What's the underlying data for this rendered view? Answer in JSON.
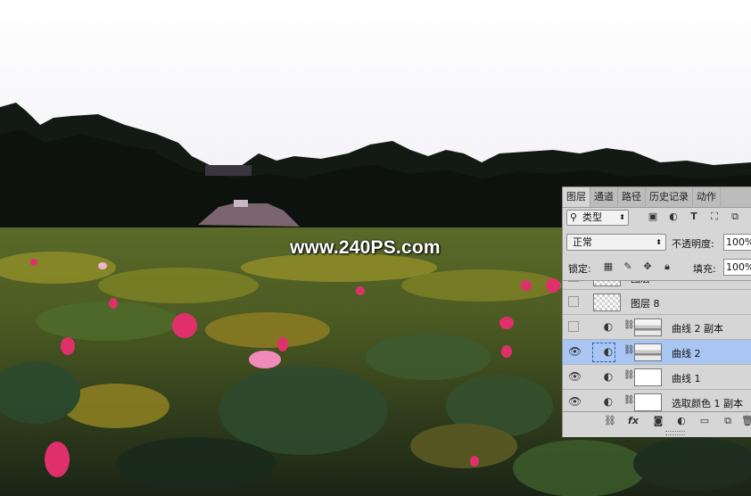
{
  "watermark": "www.240PS.com",
  "layers_panel": {
    "tabs": [
      "图层",
      "通道",
      "路径",
      "历史记录",
      "动作"
    ],
    "active_tab": "图层",
    "kind_filter": "类型",
    "blend_mode": "正常",
    "opacity_label": "不透明度:",
    "opacity_value": "100%",
    "lock_label": "锁定:",
    "fill_label": "填充:",
    "fill_value": "100%",
    "layers": [
      {
        "name": "图层",
        "visible": false,
        "partial": true
      },
      {
        "name": "图层 8",
        "visible": false
      },
      {
        "name": "曲线 2 副本",
        "visible": false
      },
      {
        "name": "曲线 2",
        "visible": true,
        "selected": true
      },
      {
        "name": "曲线 1",
        "visible": true
      },
      {
        "name": "选取颜色 1 副本",
        "visible": true
      }
    ],
    "bottom_icons": [
      "link-icon",
      "fx-icon",
      "mask-icon",
      "adjustment-icon",
      "folder-icon",
      "new-layer-icon",
      "trash-icon"
    ]
  }
}
